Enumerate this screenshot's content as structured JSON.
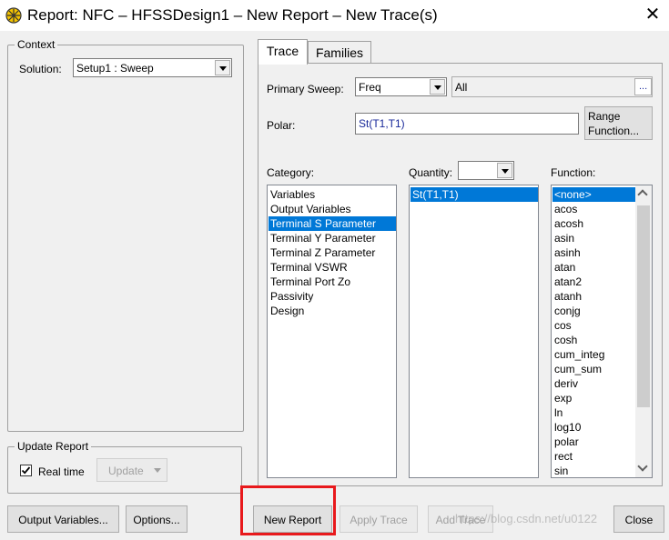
{
  "window": {
    "title": "Report: NFC – HFSSDesign1 – New Report – New Trace(s)",
    "close_glyph": "✕"
  },
  "context": {
    "legend": "Context",
    "solution_label": "Solution:",
    "solution_value": "Setup1 : Sweep"
  },
  "update_report": {
    "legend": "Update Report",
    "realtime_label": "Real time",
    "realtime_checked": true,
    "update_button": "Update"
  },
  "tabs": {
    "trace": "Trace",
    "families": "Families"
  },
  "trace": {
    "primary_sweep_label": "Primary Sweep:",
    "primary_sweep_value": "Freq",
    "sweep_range_value": "All",
    "ellipsis_button": "...",
    "polar_label": "Polar:",
    "polar_value": "St(T1,T1)",
    "range_function_button_line1": "Range",
    "range_function_button_line2": "Function...",
    "category_label": "Category:",
    "quantity_label": "Quantity:",
    "quantity_filter_value": "",
    "function_label": "Function:",
    "categories": [
      "Variables",
      "Output Variables",
      "Terminal S Parameter",
      "Terminal Y Parameter",
      "Terminal Z Parameter",
      "Terminal VSWR",
      "Terminal Port Zo",
      "Passivity",
      "Design"
    ],
    "selected_category": "Terminal S Parameter",
    "quantities": [
      "St(T1,T1)"
    ],
    "selected_quantity": "St(T1,T1)",
    "functions": [
      "<none>",
      "acos",
      "acosh",
      "asin",
      "asinh",
      "atan",
      "atan2",
      "atanh",
      "conjg",
      "cos",
      "cosh",
      "cum_integ",
      "cum_sum",
      "deriv",
      "exp",
      "ln",
      "log10",
      "polar",
      "rect",
      "sin"
    ],
    "selected_function": "<none>"
  },
  "buttons": {
    "output_variables": "Output Variables...",
    "options": "Options...",
    "new_report": "New Report",
    "apply_trace": "Apply Trace",
    "add_trace": "Add Trace",
    "close": "Close"
  },
  "watermark": "https://blog.csdn.net/u0122"
}
